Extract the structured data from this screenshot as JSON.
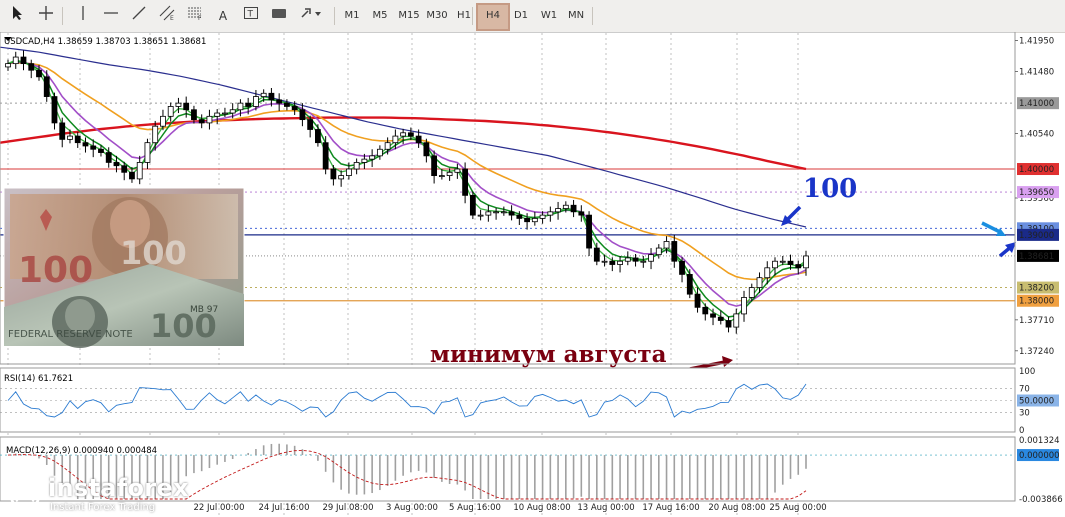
{
  "toolbar": {
    "timeframes": [
      "M1",
      "M5",
      "M15",
      "M30",
      "H1",
      "H4",
      "D1",
      "W1",
      "MN"
    ],
    "active_timeframe": "H4"
  },
  "chart_header": {
    "main": "USDCAD,H4 1.38659 1.38703 1.38651 1.38681",
    "rsi": "RSI(14) 61.7621",
    "macd": "MACD(12,26,9) 0.000940 0.000484"
  },
  "annotations": {
    "label_100": "100",
    "august_low": "минимум августа"
  },
  "watermark": {
    "brand": "instaforex",
    "tagline": "Instant Forex Trading"
  },
  "colors": {
    "ma200": "#d9141e",
    "ma100": "#2b2f8f",
    "ma_orange": "#f0a020",
    "ma_violet": "#a24fc8",
    "ma_green1": "#0e8a1e",
    "ma_green2": "#3bb041",
    "candle": "#000000",
    "label_blue": "#1a35c8",
    "label_maroon": "#7a0010",
    "rsi_line": "#2b7bd1",
    "macd_hist": "#a0a0a0",
    "macd_signal": "#c21818"
  },
  "chart_data": {
    "type": "candlestick",
    "symbol": "USDCAD",
    "timeframe": "H4",
    "ohlc_last": {
      "open": 1.38659,
      "high": 1.38703,
      "low": 1.38651,
      "close": 1.38681
    },
    "x_ticks": [
      "22 Jul 00:00",
      "24 Jul 16:00",
      "29 Jul 08:00",
      "3 Aug 00:00",
      "5 Aug 16:00",
      "10 Aug 08:00",
      "13 Aug 00:00",
      "17 Aug 16:00",
      "20 Aug 08:00",
      "25 Aug 00:00"
    ],
    "y_ticks": [
      1.4195,
      1.4148,
      1.4054,
      1.3956,
      1.3771,
      1.3724
    ],
    "ylim": [
      1.3707,
      1.4205
    ],
    "price_labels": [
      {
        "value": 1.41,
        "text": "1.41000",
        "style": "gray"
      },
      {
        "value": 1.4,
        "text": "1.40000",
        "style": "red"
      },
      {
        "value": 1.3965,
        "text": "1.39650",
        "style": "violet"
      },
      {
        "value": 1.391,
        "text": "1.39100",
        "style": "blue"
      },
      {
        "value": 1.39,
        "text": "1.39000",
        "style": "navy"
      },
      {
        "value": 1.38681,
        "text": "1.38681",
        "style": "black"
      },
      {
        "value": 1.382,
        "text": "1.38200",
        "style": "olive"
      },
      {
        "value": 1.38,
        "text": "1.38000",
        "style": "orange"
      }
    ],
    "closes": [
      1.416,
      1.417,
      1.416,
      1.415,
      1.414,
      1.411,
      1.407,
      1.4045,
      1.405,
      1.404,
      1.4035,
      1.403,
      1.4025,
      1.401,
      1.4005,
      1.3995,
      1.3985,
      1.401,
      1.404,
      1.4065,
      1.408,
      1.4095,
      1.41,
      1.409,
      1.4075,
      1.407,
      1.408,
      1.4085,
      1.4085,
      1.409,
      1.41,
      1.4095,
      1.411,
      1.4115,
      1.4105,
      1.41,
      1.4095,
      1.409,
      1.4075,
      1.406,
      1.404,
      1.4,
      1.3985,
      1.399,
      1.4,
      1.401,
      1.4015,
      1.402,
      1.403,
      1.404,
      1.405,
      1.4055,
      1.405,
      1.404,
      1.402,
      1.399,
      1.399,
      1.3995,
      1.4,
      1.396,
      1.393,
      1.393,
      1.3935,
      1.3935,
      1.3935,
      1.393,
      1.3925,
      1.392,
      1.3925,
      1.393,
      1.3935,
      1.394,
      1.3945,
      1.3935,
      1.393,
      1.388,
      1.386,
      1.386,
      1.3855,
      1.386,
      1.3865,
      1.386,
      1.386,
      1.387,
      1.388,
      1.389,
      1.386,
      1.384,
      1.381,
      1.379,
      1.378,
      1.3775,
      1.377,
      1.376,
      1.378,
      1.3805,
      1.382,
      1.3835,
      1.385,
      1.386,
      1.386,
      1.3855,
      1.385,
      1.3868
    ],
    "ma200": [
      1.404,
      1.4047,
      1.4054,
      1.406,
      1.4065,
      1.4069,
      1.4072,
      1.4074,
      1.4076,
      1.4077,
      1.4078,
      1.4078,
      1.4078,
      1.4077,
      1.4075,
      1.4073,
      1.407,
      1.4066,
      1.4061,
      1.4055,
      1.4048,
      1.404,
      1.4031,
      1.4021,
      1.401,
      1.4
    ],
    "ma100": [
      1.4185,
      1.4178,
      1.4168,
      1.4158,
      1.415,
      1.414,
      1.4128,
      1.4114,
      1.41,
      1.4086,
      1.4072,
      1.406,
      1.405,
      1.404,
      1.403,
      1.402,
      1.4005,
      1.399,
      1.3975,
      1.3958,
      1.394,
      1.3925,
      1.3912
    ],
    "rsi": {
      "value": 61.7621,
      "levels": [
        70,
        50,
        30
      ],
      "ticks": [
        100,
        70,
        30,
        0
      ],
      "label_50": "50.0000"
    },
    "macd": {
      "main": 0.00094,
      "signal": 0.000484,
      "ticks": [
        0.001324,
        -0.003866
      ],
      "label_zero": "0.000000"
    }
  }
}
